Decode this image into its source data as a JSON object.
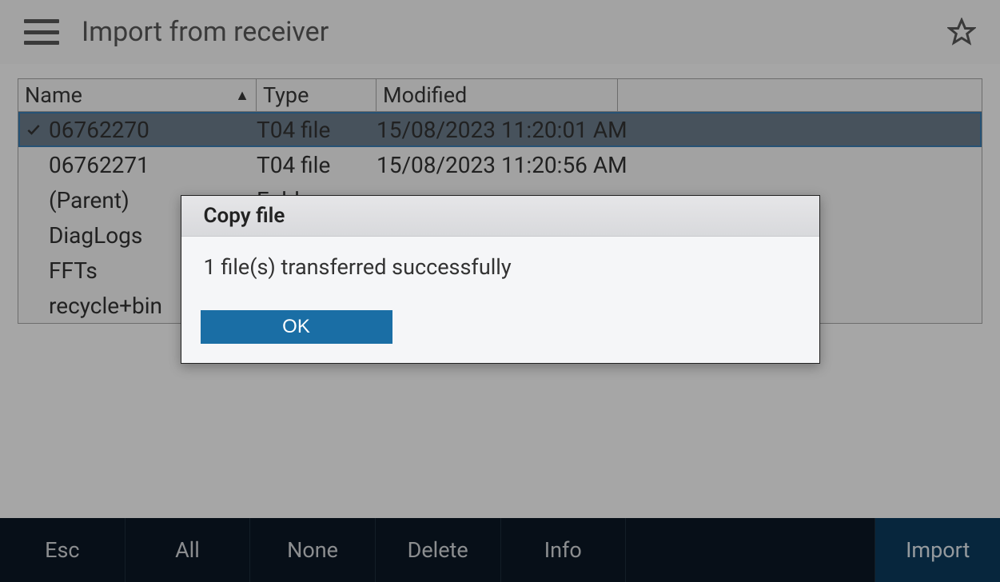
{
  "header": {
    "title": "Import from receiver"
  },
  "table": {
    "columns": {
      "name": "Name",
      "type": "Type",
      "modified": "Modified"
    },
    "rows": [
      {
        "selected": true,
        "name": "06762270",
        "type": "T04 file",
        "modified": "15/08/2023 11:20:01 AM"
      },
      {
        "selected": false,
        "name": "06762271",
        "type": "T04 file",
        "modified": "15/08/2023 11:20:56 AM"
      },
      {
        "selected": false,
        "name": "(Parent)",
        "type": "Folder",
        "modified": ""
      },
      {
        "selected": false,
        "name": "DiagLogs",
        "type": "",
        "modified": ""
      },
      {
        "selected": false,
        "name": "FFTs",
        "type": "",
        "modified": ""
      },
      {
        "selected": false,
        "name": "recycle+bin",
        "type": "",
        "modified": ""
      }
    ]
  },
  "dialog": {
    "title": "Copy file",
    "message": "1 file(s) transferred successfully",
    "ok": "OK"
  },
  "bottombar": {
    "esc": "Esc",
    "all": "All",
    "none": "None",
    "delete": "Delete",
    "info": "Info",
    "import": "Import"
  }
}
